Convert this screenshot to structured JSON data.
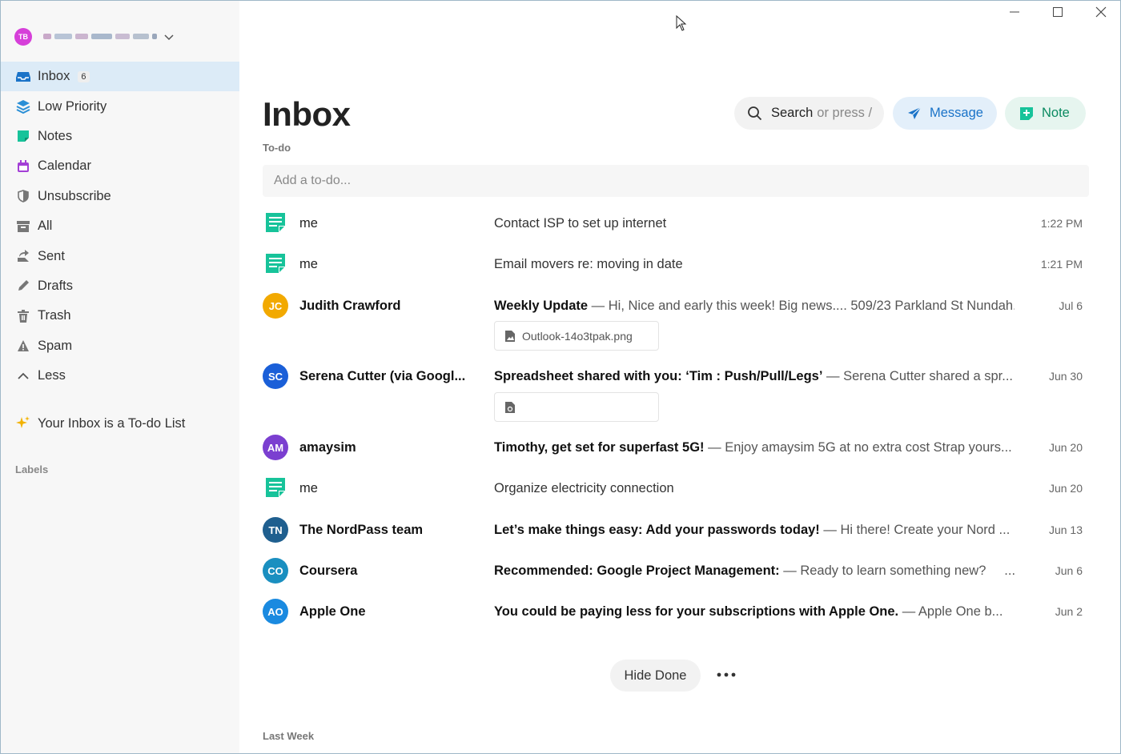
{
  "account": {
    "initials": "TB"
  },
  "sidebar": {
    "items": [
      {
        "label": "Inbox",
        "badge": "6",
        "icon": "inbox-icon"
      },
      {
        "label": "Low Priority",
        "icon": "layers-icon"
      },
      {
        "label": "Notes",
        "icon": "note-icon"
      },
      {
        "label": "Calendar",
        "icon": "calendar-icon"
      },
      {
        "label": "Unsubscribe",
        "icon": "shield-icon"
      },
      {
        "label": "All",
        "icon": "archive-icon"
      },
      {
        "label": "Sent",
        "icon": "send-icon"
      },
      {
        "label": "Drafts",
        "icon": "pencil-icon"
      },
      {
        "label": "Trash",
        "icon": "trash-icon"
      },
      {
        "label": "Spam",
        "icon": "warning-icon"
      },
      {
        "label": "Less",
        "icon": "chevron-up-icon"
      }
    ],
    "tip": "Your Inbox is a To-do List",
    "labels_heading": "Labels"
  },
  "header": {
    "title": "Inbox",
    "section": "To-do",
    "search_text": "Search",
    "search_hint": "or press /",
    "message_label": "Message",
    "note_label": "Note"
  },
  "todo": {
    "placeholder": "Add a to-do..."
  },
  "rows": [
    {
      "type": "note",
      "sender": "me",
      "subject": "",
      "preview": "Contact ISP to set up internet",
      "date": "1:22 PM"
    },
    {
      "type": "note",
      "sender": "me",
      "subject": "",
      "preview": "Email movers re: moving in date",
      "date": "1:21 PM"
    },
    {
      "type": "mail",
      "initials": "JC",
      "color": "#f2a900",
      "sender": "Judith Crawford",
      "subject": "Weekly Update",
      "preview": " — Hi, Nice and early this week! Big news.... 509/23 Parkland St Nundah...",
      "date": "Jul 6",
      "attachment": "Outlook-14o3tpak.png"
    },
    {
      "type": "mail",
      "initials": "SC",
      "color": "#1a5fd8",
      "sender": "Serena Cutter (via Googl...",
      "subject": "Spreadsheet shared with you: ‘Tim : Push/Pull/Legs’",
      "preview": " — Serena Cutter shared a spr...",
      "date": "Jun 30",
      "attachment": ""
    },
    {
      "type": "mail",
      "initials": "AM",
      "color": "#7b3fd0",
      "sender": "amaysim",
      "subject": "Timothy, get set for superfast 5G!",
      "preview": " — Enjoy amaysim 5G at no extra cost Strap yours...",
      "date": "Jun 20"
    },
    {
      "type": "note",
      "sender": "me",
      "subject": "",
      "preview": "Organize electricity connection",
      "date": "Jun 20"
    },
    {
      "type": "mail",
      "initials": "TN",
      "color": "#1f5f8f",
      "sender": "The NordPass team",
      "subject": "Let’s make things easy: Add your passwords today!",
      "preview": " — Hi there! Create your Nord ...",
      "date": "Jun 13"
    },
    {
      "type": "mail",
      "initials": "CO",
      "color": "#1a8fc0",
      "sender": "Coursera",
      "subject": "Recommended: Google Project Management:",
      "preview": " — Ready to learn something new?     ...",
      "date": "Jun 6"
    },
    {
      "type": "mail",
      "initials": "AO",
      "color": "#1a8ae0",
      "sender": "Apple One",
      "subject": "You could be paying less for your subscriptions with Apple One.",
      "preview": " — Apple One b...",
      "date": "Jun 2"
    }
  ],
  "footer": {
    "hide_done": "Hide Done",
    "last_week": "Last Week"
  }
}
